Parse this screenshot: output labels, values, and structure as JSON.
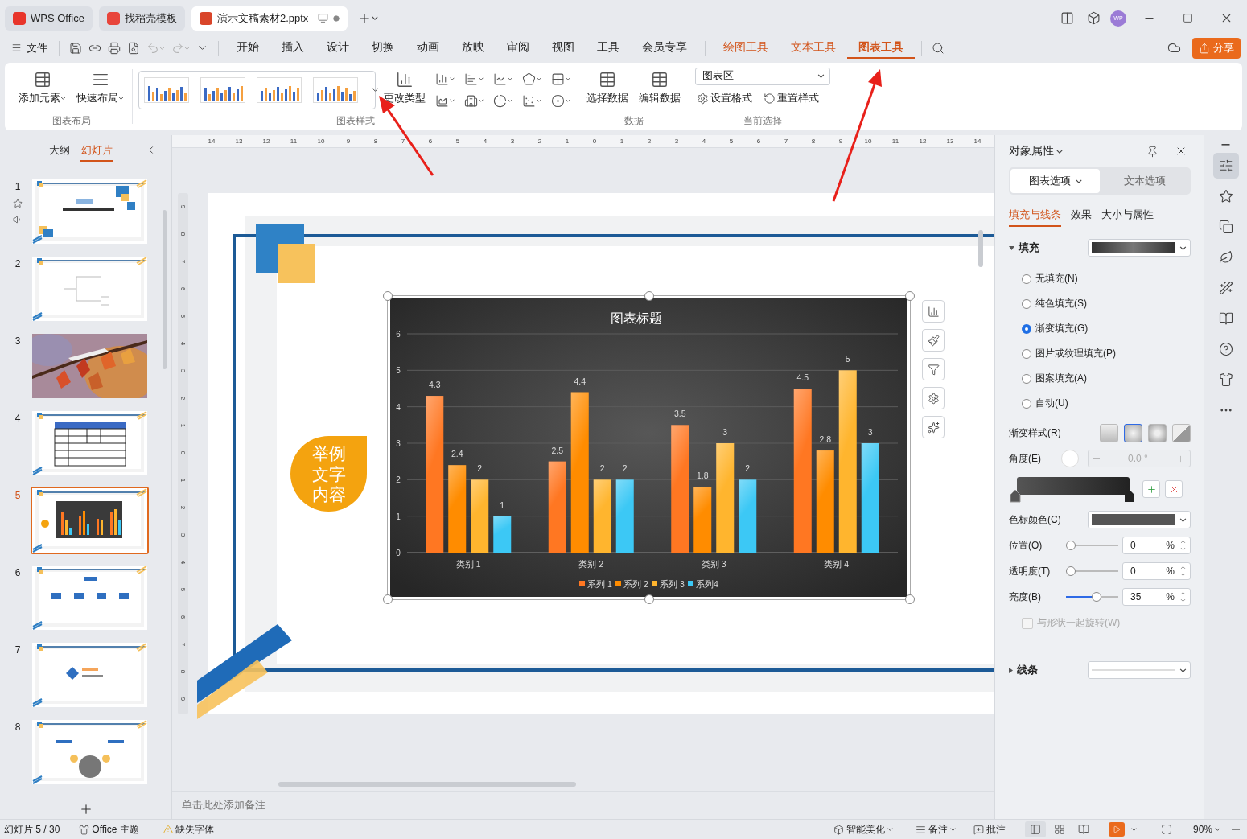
{
  "title_bar": {
    "tabs": [
      {
        "label": "WPS Office",
        "kind": "home",
        "selected": false
      },
      {
        "label": "找稻壳模板",
        "kind": "docer",
        "selected": false
      },
      {
        "label": "演示文稿素材2.pptx",
        "kind": "doc",
        "selected": true
      }
    ],
    "avatar": "WP"
  },
  "menu_bar": {
    "file": "文件",
    "items": [
      {
        "label": "开始",
        "kind": "main",
        "selected": false
      },
      {
        "label": "插入",
        "kind": "main",
        "selected": false
      },
      {
        "label": "设计",
        "kind": "main",
        "selected": false
      },
      {
        "label": "切换",
        "kind": "main",
        "selected": false
      },
      {
        "label": "动画",
        "kind": "main",
        "selected": false
      },
      {
        "label": "放映",
        "kind": "main",
        "selected": false
      },
      {
        "label": "审阅",
        "kind": "main",
        "selected": false
      },
      {
        "label": "视图",
        "kind": "main",
        "selected": false
      },
      {
        "label": "工具",
        "kind": "main",
        "selected": false
      },
      {
        "label": "会员专享",
        "kind": "main",
        "selected": false
      },
      {
        "label": "绘图工具",
        "kind": "context",
        "selected": false
      },
      {
        "label": "文本工具",
        "kind": "context",
        "selected": false
      },
      {
        "label": "图表工具",
        "kind": "context",
        "selected": true
      }
    ],
    "share": "分享"
  },
  "ribbon": {
    "layout": {
      "label": "图表布局",
      "buttons": [
        "添加元素",
        "快速布局"
      ]
    },
    "styles": {
      "label": "图表样式",
      "change_type": "更改类型"
    },
    "data": {
      "label": "数据",
      "buttons": [
        "选择数据",
        "编辑数据"
      ]
    },
    "selection": {
      "label": "当前选择",
      "dropdown": "图表区",
      "buttons": [
        "设置格式",
        "重置样式"
      ]
    }
  },
  "slide_panel": {
    "tabs": [
      {
        "label": "大纲",
        "selected": false
      },
      {
        "label": "幻灯片",
        "selected": true
      }
    ],
    "slides": [
      {
        "number": "1",
        "kind": "title",
        "selected": false
      },
      {
        "number": "2",
        "kind": "mindmap",
        "selected": false
      },
      {
        "number": "3",
        "selected": false
      },
      {
        "number": "4",
        "kind": "table",
        "selected": false
      },
      {
        "number": "5",
        "kind": "chart",
        "selected": true
      },
      {
        "number": "6",
        "kind": "agenda",
        "selected": false
      },
      {
        "number": "7",
        "kind": "part",
        "selected": false
      },
      {
        "number": "8",
        "kind": "diagram",
        "selected": false
      }
    ]
  },
  "rulers": {
    "horizontal": [
      "14",
      "13",
      "12",
      "11",
      "10",
      "9",
      "8",
      "7",
      "6",
      "5",
      "4",
      "3",
      "2",
      "1",
      "0",
      "1",
      "2",
      "3",
      "4",
      "5",
      "6",
      "7",
      "8",
      "9",
      "10",
      "11",
      "12",
      "13",
      "14"
    ],
    "vertical": [
      "9",
      "8",
      "7",
      "6",
      "5",
      "4",
      "3",
      "2",
      "1",
      "0",
      "1",
      "2",
      "3",
      "4",
      "5",
      "6",
      "7",
      "8",
      "9"
    ]
  },
  "slide": {
    "bubble_text": "举例文字内容",
    "chart": {
      "chart_data": {
        "type": "bar",
        "title": "图表标题",
        "categories": [
          "类别 1",
          "类别 2",
          "类别 3",
          "类别 4"
        ],
        "series": [
          {
            "name": "系列 1",
            "color": "#ff7722",
            "values": [
              4.3,
              2.5,
              3.5,
              4.5
            ]
          },
          {
            "name": "系列 2",
            "color": "#ff8c00",
            "values": [
              2.4,
              4.4,
              1.8,
              2.8
            ]
          },
          {
            "name": "系列 3",
            "color": "#ffb52e",
            "values": [
              2,
              2,
              3,
              5
            ]
          },
          {
            "name": "系列4",
            "color": "#3cc8f5",
            "values": [
              1,
              2,
              2,
              3
            ]
          }
        ],
        "ylim": [
          0,
          6
        ],
        "yticks": [
          0,
          1,
          2,
          3,
          4,
          5,
          6
        ],
        "data_labels": true,
        "grid": true,
        "legend": true
      }
    }
  },
  "notes": {
    "placeholder": "单击此处添加备注"
  },
  "properties_panel": {
    "title": "对象属性",
    "tabs": [
      {
        "label": "图表选项",
        "selected": true
      },
      {
        "label": "文本选项",
        "selected": false
      }
    ],
    "subtabs": [
      {
        "label": "填充与线条",
        "selected": true
      },
      {
        "label": "效果",
        "selected": false
      },
      {
        "label": "大小与属性",
        "selected": false
      }
    ],
    "fill": {
      "label": "填充",
      "expanded": true,
      "options": [
        {
          "label": "无填充(N)",
          "selected": false
        },
        {
          "label": "纯色填充(S)",
          "selected": false
        },
        {
          "label": "渐变填充(G)",
          "selected": true
        },
        {
          "label": "图片或纹理填充(P)",
          "selected": false
        },
        {
          "label": "图案填充(A)",
          "selected": false
        },
        {
          "label": "自动(U)",
          "selected": false
        }
      ],
      "gradient_style": {
        "label": "渐变样式(R)",
        "styles": [
          {
            "kind": "linear",
            "selected": false
          },
          {
            "kind": "radial",
            "selected": true
          },
          {
            "kind": "rect",
            "selected": false
          },
          {
            "kind": "path",
            "selected": false
          }
        ]
      },
      "angle": {
        "label": "角度(E)",
        "value": "0.0",
        "unit": "°",
        "disabled": true
      },
      "stop_color": {
        "label": "色标颜色(C)"
      },
      "sliders": [
        {
          "label": "位置(O)",
          "level": 0,
          "value": "0",
          "unit": "%"
        },
        {
          "label": "透明度(T)",
          "level": 0,
          "value": "0",
          "unit": "%"
        },
        {
          "label": "亮度(B)",
          "level": 0.6,
          "value": "35",
          "unit": "%"
        }
      ],
      "rotate": {
        "label": "与形状一起旋转(W)",
        "checked": false,
        "disabled": true
      }
    },
    "line": {
      "label": "线条",
      "expanded": false
    }
  },
  "side_tools": [
    {
      "kind": "properties",
      "selected": true
    },
    {
      "kind": "favorites",
      "selected": false
    },
    {
      "kind": "shapes",
      "selected": false
    },
    {
      "kind": "style",
      "selected": false
    },
    {
      "kind": "magic",
      "selected": false
    },
    {
      "kind": "review",
      "selected": false
    },
    {
      "kind": "help",
      "selected": false
    },
    {
      "kind": "skin",
      "selected": false
    },
    {
      "kind": "more",
      "selected": false
    }
  ],
  "status_bar": {
    "slide": "幻灯片 5 / 30",
    "theme": "Office 主题",
    "missing_font": "缺失字体",
    "beautify": "智能美化",
    "notes": "备注",
    "comments": "批注",
    "zoom": "90%",
    "views": [
      {
        "kind": "normal",
        "selected": true
      },
      {
        "kind": "sorter",
        "selected": false
      },
      {
        "kind": "reading",
        "selected": false
      }
    ]
  }
}
